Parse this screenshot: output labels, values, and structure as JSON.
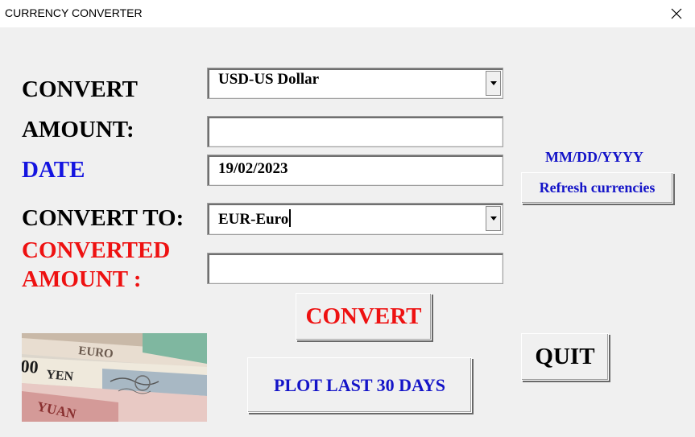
{
  "window": {
    "title": "CURRENCY CONVERTER"
  },
  "labels": {
    "convert": "CONVERT",
    "amount": "AMOUNT:",
    "date": "DATE",
    "convert_to": "CONVERT TO:",
    "converted_line1": "CONVERTED",
    "converted_line2": "AMOUNT :"
  },
  "fields": {
    "from_currency": "USD-US Dollar",
    "amount": "",
    "date": "19/02/2023",
    "to_currency": "EUR-Euro",
    "converted_amount": ""
  },
  "hints": {
    "date_format": "MM/DD/YYYY"
  },
  "buttons": {
    "refresh": "Refresh currencies",
    "convert": "CONVERT",
    "plot": "PLOT LAST 30 DAYS",
    "quit": "QUIT"
  },
  "image": {
    "notes": [
      "EURO",
      "YEN",
      "YUAN",
      "00"
    ]
  },
  "colors": {
    "blue_text": "#1414e0",
    "red_text": "#ee1111"
  }
}
